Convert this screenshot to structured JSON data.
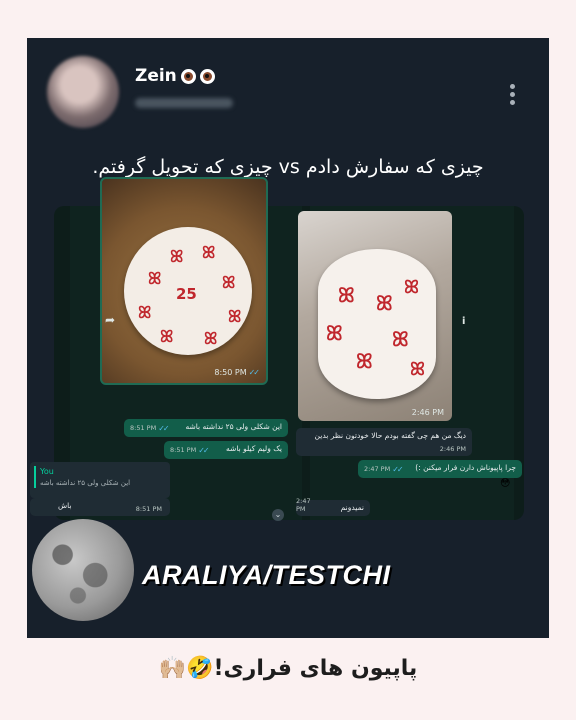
{
  "post": {
    "author": {
      "name": "Zein",
      "emoji": [
        "eye-icon",
        "eye-icon"
      ]
    },
    "text": "چیزی که سفارش دادم vs چیزی که تحویل گرفتم."
  },
  "left_chat": {
    "photo_time": "8:50 PM",
    "cake_number": "25",
    "messages": [
      {
        "text": "این شکلی ولی ۲۵ نداشته باشه",
        "time": "8:51 PM"
      },
      {
        "text": "یک ولیم کیلو باشه",
        "time": "8:51 PM"
      }
    ],
    "quote": {
      "author": "You",
      "text": "این شکلی ولی ۲۵ نداشته باشه"
    },
    "reply": {
      "text": "باش",
      "time": "8:51 PM"
    }
  },
  "right_chat": {
    "photo_time": "2:46 PM",
    "messages": [
      {
        "text": "دیگ من هم چی گفته بودم حالا خودتون نظر بدین",
        "time": "2:46 PM"
      },
      {
        "text": "چرا پاپیوناش دارن فرار میکنن :)",
        "time": "2:47 PM"
      },
      {
        "text": "نمیدونم",
        "time": "2:47 PM"
      }
    ]
  },
  "watermark": "ARALIYA/TESTCHI",
  "caption": "پاپیون های فراری!🤣🙌🏼",
  "colors": {
    "card": "#17202b",
    "page": "#fbf1f1",
    "bow": "#c0272d",
    "outgoing": "#125e4a"
  }
}
